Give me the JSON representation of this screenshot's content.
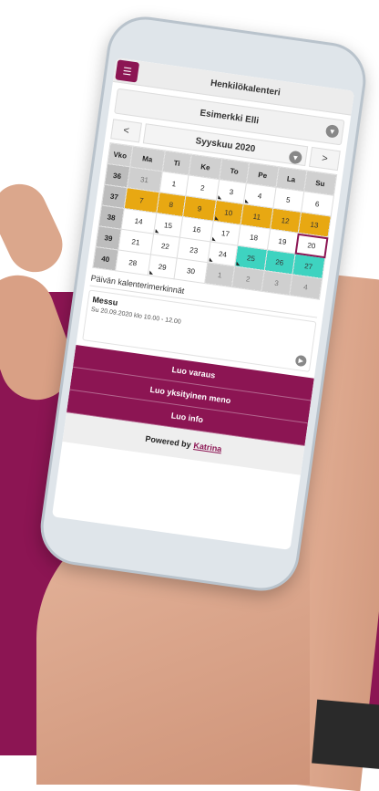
{
  "app": {
    "title": "Henkilökalenteri",
    "menu_icon": "menu-icon"
  },
  "person": {
    "name": "Esimerkki Elli"
  },
  "calendar": {
    "prev": "<",
    "next": ">",
    "month": "Syyskuu 2020",
    "headers": [
      "Vko",
      "Ma",
      "Ti",
      "Ke",
      "To",
      "Pe",
      "La",
      "Su"
    ],
    "weeks": [
      {
        "wk": "36",
        "days": [
          "31",
          "1",
          "2",
          "3",
          "4",
          "5",
          "6"
        ]
      },
      {
        "wk": "37",
        "days": [
          "7",
          "8",
          "9",
          "10",
          "11",
          "12",
          "13"
        ]
      },
      {
        "wk": "38",
        "days": [
          "14",
          "15",
          "16",
          "17",
          "18",
          "19",
          "20"
        ]
      },
      {
        "wk": "39",
        "days": [
          "21",
          "22",
          "23",
          "24",
          "25",
          "26",
          "27"
        ]
      },
      {
        "wk": "40",
        "days": [
          "28",
          "29",
          "30",
          "1",
          "2",
          "3",
          "4"
        ]
      }
    ]
  },
  "section": {
    "title": "Päivän kalenterimerkinnät"
  },
  "event": {
    "title": "Messu",
    "time": "Su 20.09.2020 klo 10.00 - 12.00"
  },
  "actions": [
    "Luo varaus",
    "Luo yksityinen meno",
    "Luo info"
  ],
  "footer": {
    "prefix": "Powered by",
    "brand": "Katrina"
  },
  "colors": {
    "accent": "#8c1553",
    "busy": "#e8a812",
    "free": "#3ed3c0"
  }
}
